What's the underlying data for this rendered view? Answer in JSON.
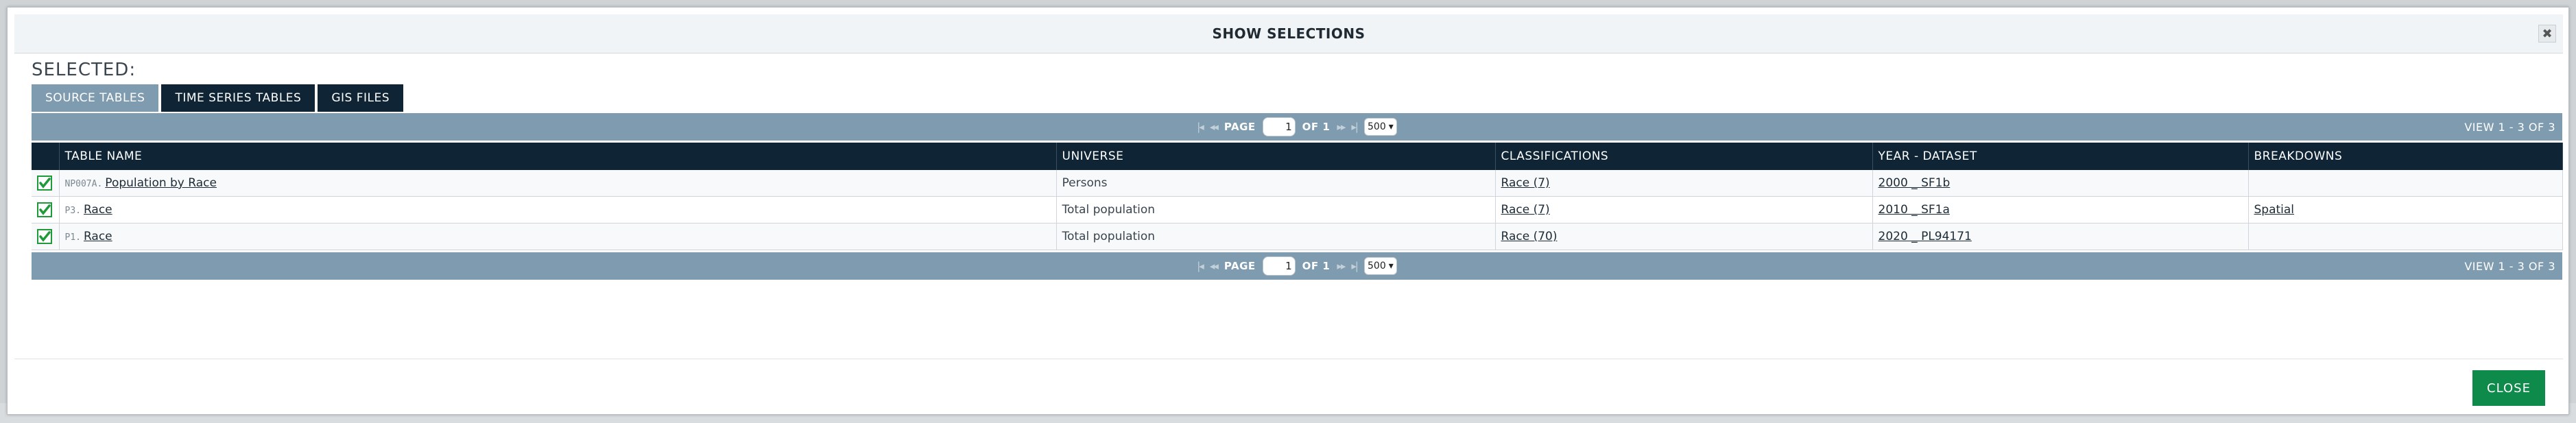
{
  "modal": {
    "title": "SHOW SELECTIONS",
    "close_x": "✖",
    "selected_label": "SELECTED:",
    "tabs": [
      {
        "label": "SOURCE TABLES",
        "active": true
      },
      {
        "label": "TIME SERIES TABLES",
        "active": false
      },
      {
        "label": "GIS FILES",
        "active": false
      }
    ],
    "pager": {
      "first": "|◂",
      "prev": "◂◂",
      "page_word": "PAGE",
      "page_value": "1",
      "of_text": "OF 1",
      "next": "▸▸",
      "last": "▸|",
      "per_page": "500",
      "view_text": "VIEW 1 - 3 OF 3"
    },
    "columns": [
      "TABLE NAME",
      "UNIVERSE",
      "CLASSIFICATIONS",
      "YEAR - DATASET",
      "BREAKDOWNS"
    ],
    "rows": [
      {
        "id": "NP007A.",
        "name": "Population by Race",
        "universe": "Persons",
        "classification": "Race (7)",
        "dataset": "2000 _ SF1b",
        "breakdown": ""
      },
      {
        "id": "P3.",
        "name": "Race",
        "universe": "Total population",
        "classification": "Race (7)",
        "dataset": "2010 _ SF1a",
        "breakdown": "Spatial"
      },
      {
        "id": "P1.",
        "name": "Race",
        "universe": "Total population",
        "classification": "Race (70)",
        "dataset": "2020 _ PL94171",
        "breakdown": ""
      }
    ],
    "close_button": "CLOSE"
  },
  "colors": {
    "header_dark": "#0f2434",
    "pager_bg": "#7f9bb0",
    "close_green": "#0e8a4b",
    "check_green": "#1f9a3a"
  }
}
